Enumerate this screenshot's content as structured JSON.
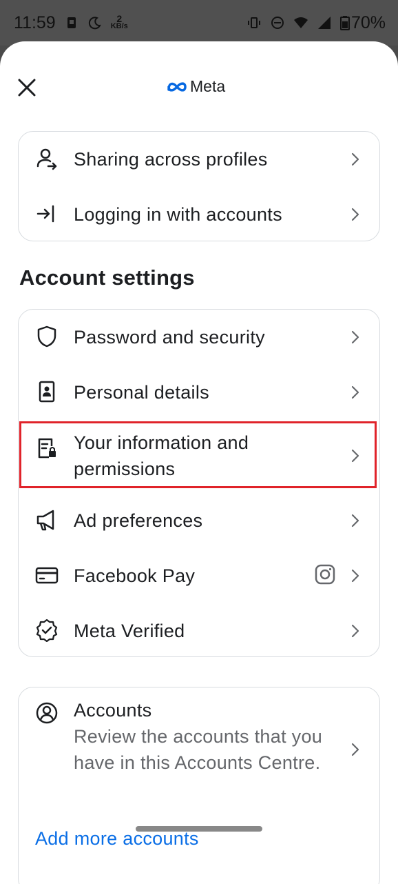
{
  "status_bar": {
    "time": "11:59",
    "speed_value": "2",
    "speed_unit": "KB/s",
    "battery": "70%"
  },
  "header": {
    "logo_text": "Meta"
  },
  "profiles_card": {
    "items": [
      {
        "label": "Sharing across profiles",
        "icon": "person-share-icon"
      },
      {
        "label": "Logging in with accounts",
        "icon": "login-arrow-icon"
      }
    ]
  },
  "account_settings": {
    "title": "Account settings",
    "items": [
      {
        "label": "Password and security",
        "icon": "shield-icon"
      },
      {
        "label": "Personal details",
        "icon": "id-card-icon"
      },
      {
        "label_line1": "Your information and",
        "label_line2": "permissions",
        "icon": "document-lock-icon",
        "highlighted": true
      },
      {
        "label": "Ad preferences",
        "icon": "megaphone-icon"
      },
      {
        "label": "Facebook Pay",
        "icon": "credit-card-icon",
        "extra_icon": "instagram-icon"
      },
      {
        "label": "Meta Verified",
        "icon": "verified-badge-icon"
      }
    ]
  },
  "accounts_card": {
    "title": "Accounts",
    "description": "Review the accounts that you have in this Accounts Centre.",
    "add_more": "Add more accounts"
  },
  "colors": {
    "highlight": "#e0232a",
    "link": "#0a6ee6",
    "meta_blue": "#0668e1"
  }
}
